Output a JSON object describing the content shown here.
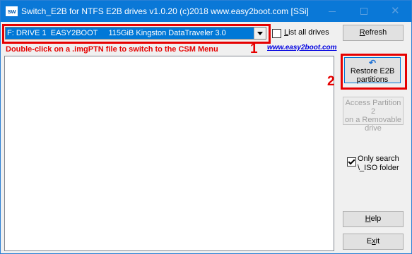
{
  "titlebar": {
    "icon_text": "sw",
    "title": "Switch_E2B  for NTFS E2B drives    v1.0.20  (c)2018 www.easy2boot.com [SSi]"
  },
  "drive": {
    "selected": "F: DRIVE 1  EASY2BOOT     115GiB Kingston DataTraveler 3.0"
  },
  "list_all": {
    "label_u": "L",
    "label_rest": "ist all drives",
    "checked": false
  },
  "instruction": "Double-click on a .imgPTN file to switch to the CSM Menu",
  "site_link": "www.easy2boot.com",
  "markers": {
    "one": "1",
    "two": "2"
  },
  "buttons": {
    "refresh_u": "R",
    "refresh_rest": "efresh",
    "restore_line1": "Restore E2B",
    "restore_line2": "partitions",
    "access_line1": "Access Partition 2",
    "access_line2": "on a Removable",
    "access_line3": "drive",
    "help_u": "H",
    "help_rest": "elp",
    "exit_pre": "E",
    "exit_u": "x",
    "exit_rest": "it"
  },
  "only_iso": {
    "line1": "Only search",
    "line2": "\\_ISO folder",
    "checked": true
  },
  "colors": {
    "accent": "#0078d7",
    "highlight": "#e60000",
    "link": "#0000e0"
  }
}
